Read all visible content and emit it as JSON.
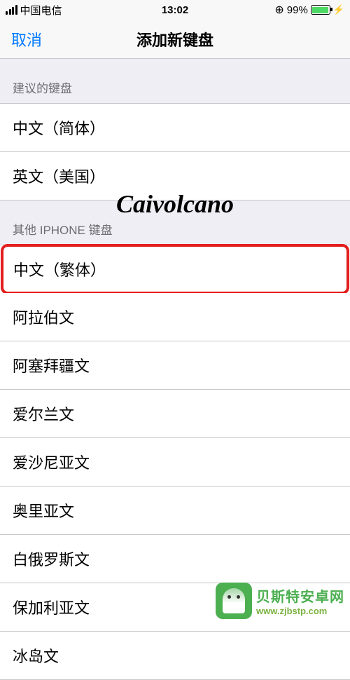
{
  "status": {
    "carrier": "中国电信",
    "time": "13:02",
    "battery_pct": "99%"
  },
  "nav": {
    "cancel": "取消",
    "title": "添加新键盘"
  },
  "sections": {
    "suggested": {
      "header": "建议的键盘",
      "items": [
        "中文（简体）",
        "英文（美国）"
      ]
    },
    "other": {
      "header": "其他 IPHONE 键盘",
      "items": [
        "中文（繁体）",
        "阿拉伯文",
        "阿塞拜疆文",
        "爱尔兰文",
        "爱沙尼亚文",
        "奥里亚文",
        "白俄罗斯文",
        "保加利亚文",
        "冰岛文"
      ]
    }
  },
  "watermark": {
    "center": "Caivolcano",
    "footer_main": "贝斯特安卓网",
    "footer_sub": "www.zjbstp.com"
  }
}
